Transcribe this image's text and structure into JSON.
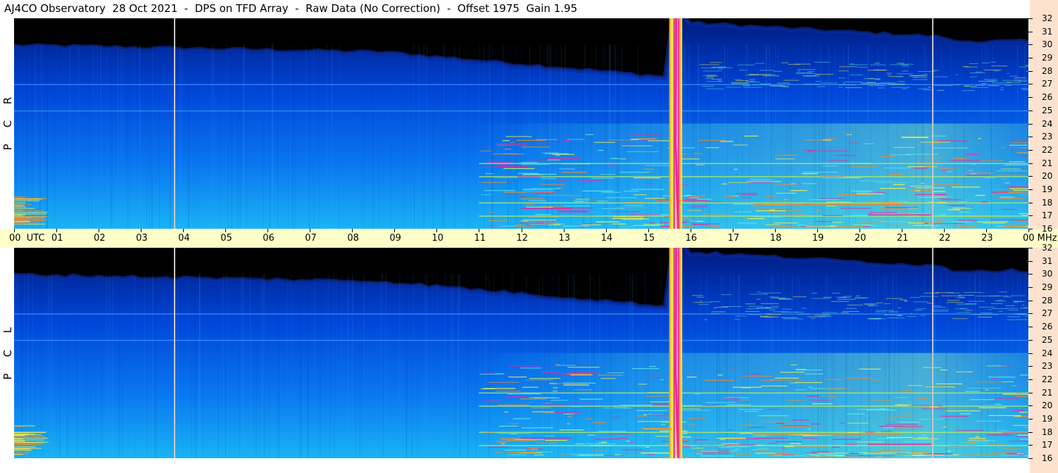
{
  "title": "AJ4CO Observatory  28 Oct 2021  -  DPS on TFD Array  -  Raw Data (No Correction)  -  Offset 1975  Gain 1.95",
  "chart_data": {
    "type": "heatmap",
    "panels": [
      {
        "name": "R C P",
        "letters": [
          "R",
          "C",
          "P"
        ]
      },
      {
        "name": "L C P",
        "letters": [
          "L",
          "C",
          "P"
        ]
      }
    ],
    "x_axis": {
      "unit": "UTC",
      "labels": [
        "00",
        "01",
        "02",
        "03",
        "04",
        "05",
        "06",
        "07",
        "08",
        "09",
        "10",
        "11",
        "12",
        "13",
        "14",
        "15",
        "16",
        "17",
        "18",
        "19",
        "20",
        "21",
        "22",
        "23",
        "00"
      ],
      "range_hours": [
        0,
        24
      ]
    },
    "y_axis": {
      "unit": "MHz",
      "labels": [
        "32",
        "31",
        "30",
        "29",
        "28",
        "27",
        "26",
        "25",
        "24",
        "23",
        "22",
        "21",
        "20",
        "19",
        "18",
        "17",
        "16"
      ],
      "range_mhz": [
        16,
        32
      ]
    },
    "colormap": [
      "#000000",
      "#001a80",
      "#0046d8",
      "#0a78f0",
      "#19b4f5",
      "#5ee6e6",
      "#f0f050",
      "#f08a28",
      "#f0289a"
    ],
    "interference_lines_mhz": [
      27.0,
      25.0,
      21.0,
      20.0,
      18.0,
      17.0
    ],
    "burst_utc_hours": [
      15.5,
      15.8
    ],
    "vertical_marker_utc_hours": [
      3.78,
      21.72
    ],
    "features": [
      "pale blue noise floor",
      "black region above ~30 MHz before 16 UTC",
      "rfi lines after 11 UTC"
    ]
  }
}
